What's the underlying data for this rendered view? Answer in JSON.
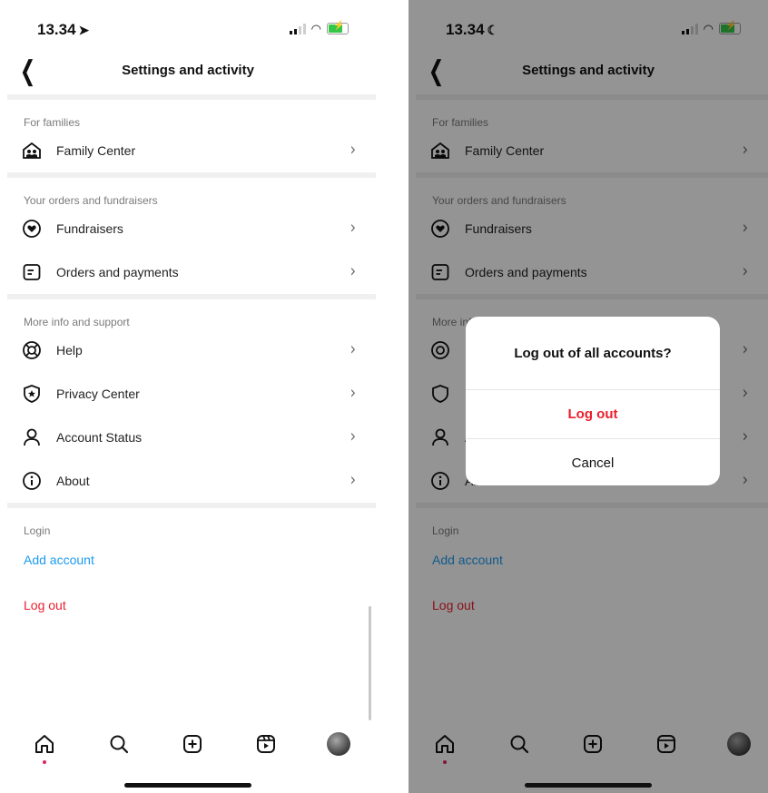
{
  "left_screen": {
    "status": {
      "time": "13.34",
      "time_glyph": "➤"
    },
    "header": {
      "title": "Settings and activity"
    },
    "sections": [
      {
        "label": "For families",
        "items": [
          {
            "label": "Family Center",
            "icon": "family-center-icon"
          }
        ]
      },
      {
        "label": "Your orders and fundraisers",
        "items": [
          {
            "label": "Fundraisers",
            "icon": "fundraisers-icon"
          },
          {
            "label": "Orders and payments",
            "icon": "orders-icon"
          }
        ]
      },
      {
        "label": "More info and support",
        "items": [
          {
            "label": "Help",
            "icon": "help-icon"
          },
          {
            "label": "Privacy Center",
            "icon": "privacy-center-icon"
          },
          {
            "label": "Account Status",
            "icon": "account-status-icon"
          },
          {
            "label": "About",
            "icon": "about-icon"
          }
        ]
      }
    ],
    "login": {
      "label": "Login",
      "add_account": "Add account",
      "log_out": "Log out"
    }
  },
  "right_screen": {
    "status": {
      "time": "13.34",
      "time_glyph": "☾"
    },
    "header": {
      "title": "Settings and activity"
    },
    "dialog": {
      "title": "Log out of all accounts?",
      "confirm": "Log out",
      "cancel": "Cancel"
    }
  },
  "tabbar": [
    "home-icon",
    "search-icon",
    "create-icon",
    "reels-icon",
    "profile-avatar"
  ],
  "colors": {
    "link_blue": "#1c9bef",
    "destructive_red": "#ec1e2d",
    "battery_green": "#33c748",
    "overlay": "rgba(0,0,0,0.42)"
  }
}
